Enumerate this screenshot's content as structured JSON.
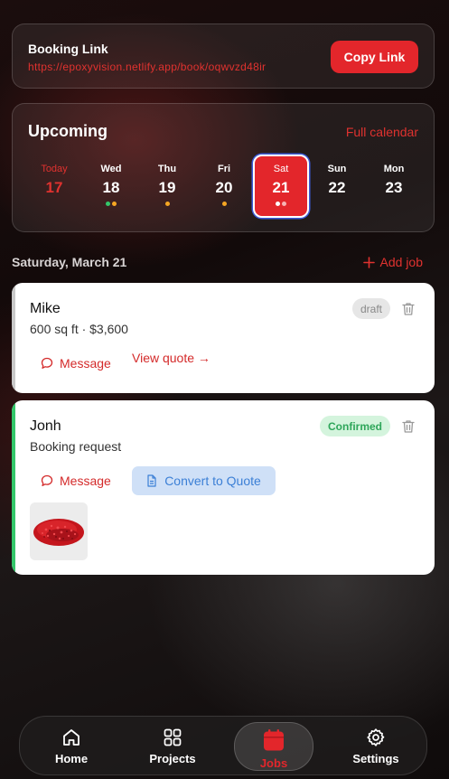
{
  "booking": {
    "title": "Booking Link",
    "url": "https://epoxyvision.netlify.app/book/oqwvzd48ir",
    "copy_label": "Copy Link"
  },
  "upcoming": {
    "title": "Upcoming",
    "full_calendar_label": "Full calendar",
    "days": [
      {
        "name": "Today",
        "num": "17",
        "dots": []
      },
      {
        "name": "Wed",
        "num": "18",
        "dots": [
          "#34c76a",
          "#f5a623"
        ]
      },
      {
        "name": "Thu",
        "num": "19",
        "dots": [
          "#f5a623"
        ]
      },
      {
        "name": "Fri",
        "num": "20",
        "dots": [
          "#f5a623"
        ]
      },
      {
        "name": "Sat",
        "num": "21",
        "dots": [
          "#ffffff",
          "#f7b4b4"
        ]
      },
      {
        "name": "Sun",
        "num": "22",
        "dots": []
      },
      {
        "name": "Mon",
        "num": "23",
        "dots": []
      }
    ]
  },
  "selected_date": "Saturday, March 21",
  "add_job_label": "Add job",
  "jobs": [
    {
      "name": "Mike",
      "detail": "600 sq ft · $3,600",
      "status": "draft",
      "message_label": "Message",
      "action_label": "View quote →"
    },
    {
      "name": "Jonh",
      "detail": "Booking request",
      "status": "Confirmed",
      "message_label": "Message",
      "action_label": "Convert to Quote"
    }
  ],
  "nav": {
    "home": "Home",
    "projects": "Projects",
    "jobs": "Jobs",
    "settings": "Settings"
  },
  "colors": {
    "accent": "#e3262b",
    "confirmed": "#34c76a",
    "convert": "#3b7fd6"
  }
}
